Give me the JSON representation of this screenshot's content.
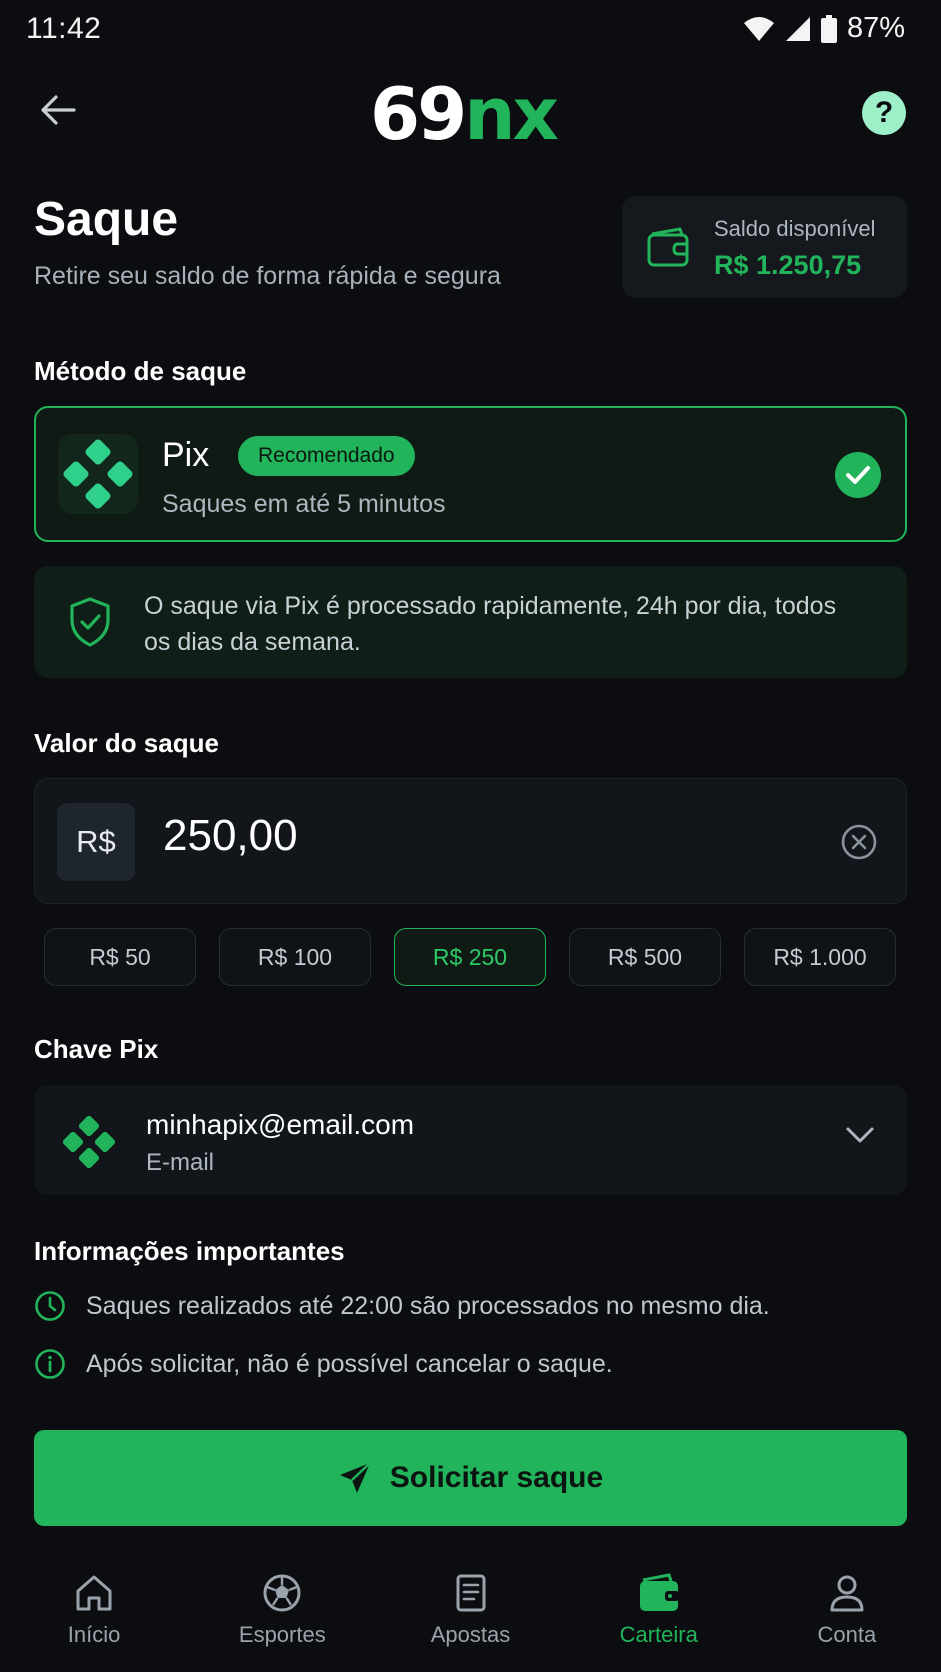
{
  "status_bar": {
    "time": "11:42",
    "battery": "87%"
  },
  "header": {
    "logo_part1": "69",
    "logo_part2": "nx"
  },
  "page": {
    "title": "Saque",
    "subtitle": "Retire seu saldo de forma rápida e segura"
  },
  "balance": {
    "label": "Saldo disponível",
    "value": "R$ 1.250,75"
  },
  "method_section": {
    "title": "Método de saque",
    "method": {
      "name": "Pix",
      "badge": "Recomendado",
      "description": "Saques em até 5 minutos"
    }
  },
  "info_banner": {
    "text": "O saque via Pix é processado rapidamente, 24h por dia, todos os dias da semana."
  },
  "amount_section": {
    "title": "Valor do saque",
    "currency": "R$",
    "value": "250,00",
    "chips": [
      "R$ 50",
      "R$ 100",
      "R$ 250",
      "R$ 500",
      "R$ 1.000"
    ],
    "selected_chip": "R$ 250"
  },
  "pix_key_section": {
    "title": "Chave Pix",
    "key": "minhapix@email.com",
    "key_type": "E-mail"
  },
  "important_info": {
    "title": "Informações importantes",
    "items": [
      {
        "icon": "clock-icon",
        "text": "Saques realizados até 22:00 são processados no mesmo dia."
      },
      {
        "icon": "info-icon",
        "text": "Após solicitar, não é possível cancelar o saque."
      }
    ]
  },
  "cta": {
    "label": "Solicitar saque"
  },
  "bottom_nav": {
    "items": [
      {
        "label": "Início",
        "icon": "home-icon"
      },
      {
        "label": "Esportes",
        "icon": "soccer-ball-icon"
      },
      {
        "label": "Apostas",
        "icon": "bet-slip-icon"
      },
      {
        "label": "Carteira",
        "icon": "wallet-icon"
      },
      {
        "label": "Conta",
        "icon": "user-icon"
      }
    ],
    "active": "Carteira"
  },
  "colors": {
    "accent": "#22b45a",
    "background": "#0b0d10",
    "card": "#12161b"
  }
}
